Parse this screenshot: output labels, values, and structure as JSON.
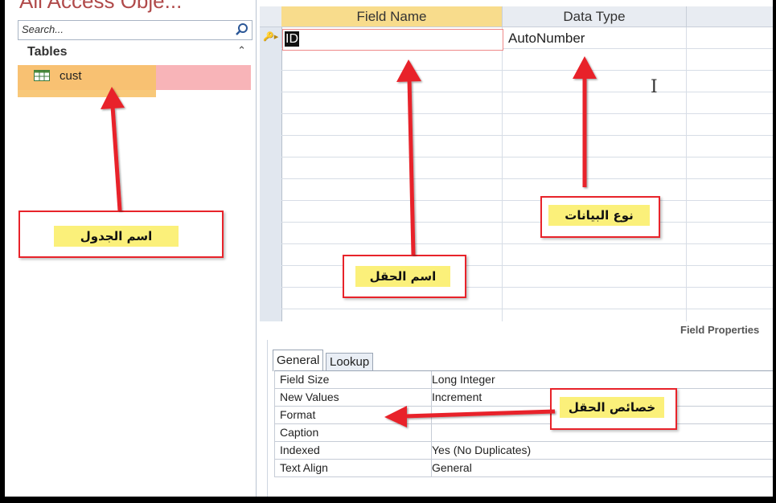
{
  "nav": {
    "title": "All Access Obje...",
    "search_placeholder": "Search...",
    "group_label": "Tables",
    "group_toggle": "⌃",
    "tables": [
      {
        "label": "cust",
        "icon": "table-icon"
      }
    ]
  },
  "grid": {
    "columns": [
      "Field Name",
      "Data Type"
    ],
    "rows": [
      {
        "field": "ID",
        "type": "AutoNumber",
        "primary_key": true
      }
    ]
  },
  "field_properties": {
    "title": "Field Properties",
    "tabs": [
      "General",
      "Lookup"
    ],
    "active_tab": "General",
    "rows": [
      {
        "name": "Field Size",
        "value": "Long Integer"
      },
      {
        "name": "New Values",
        "value": "Increment"
      },
      {
        "name": "Format",
        "value": ""
      },
      {
        "name": "Caption",
        "value": ""
      },
      {
        "name": "Indexed",
        "value": "Yes (No Duplicates)"
      },
      {
        "name": "Text Align",
        "value": "General"
      }
    ]
  },
  "annotations": {
    "table_name": "اسم الجدول",
    "field_name": "اسم الحقل",
    "data_type": "نوع البيانات",
    "field_props": "خصائص الحقل"
  },
  "colors": {
    "arrow": "#e8232a",
    "label_bg": "#fbf07a",
    "header_active": "#f8dc8c"
  }
}
